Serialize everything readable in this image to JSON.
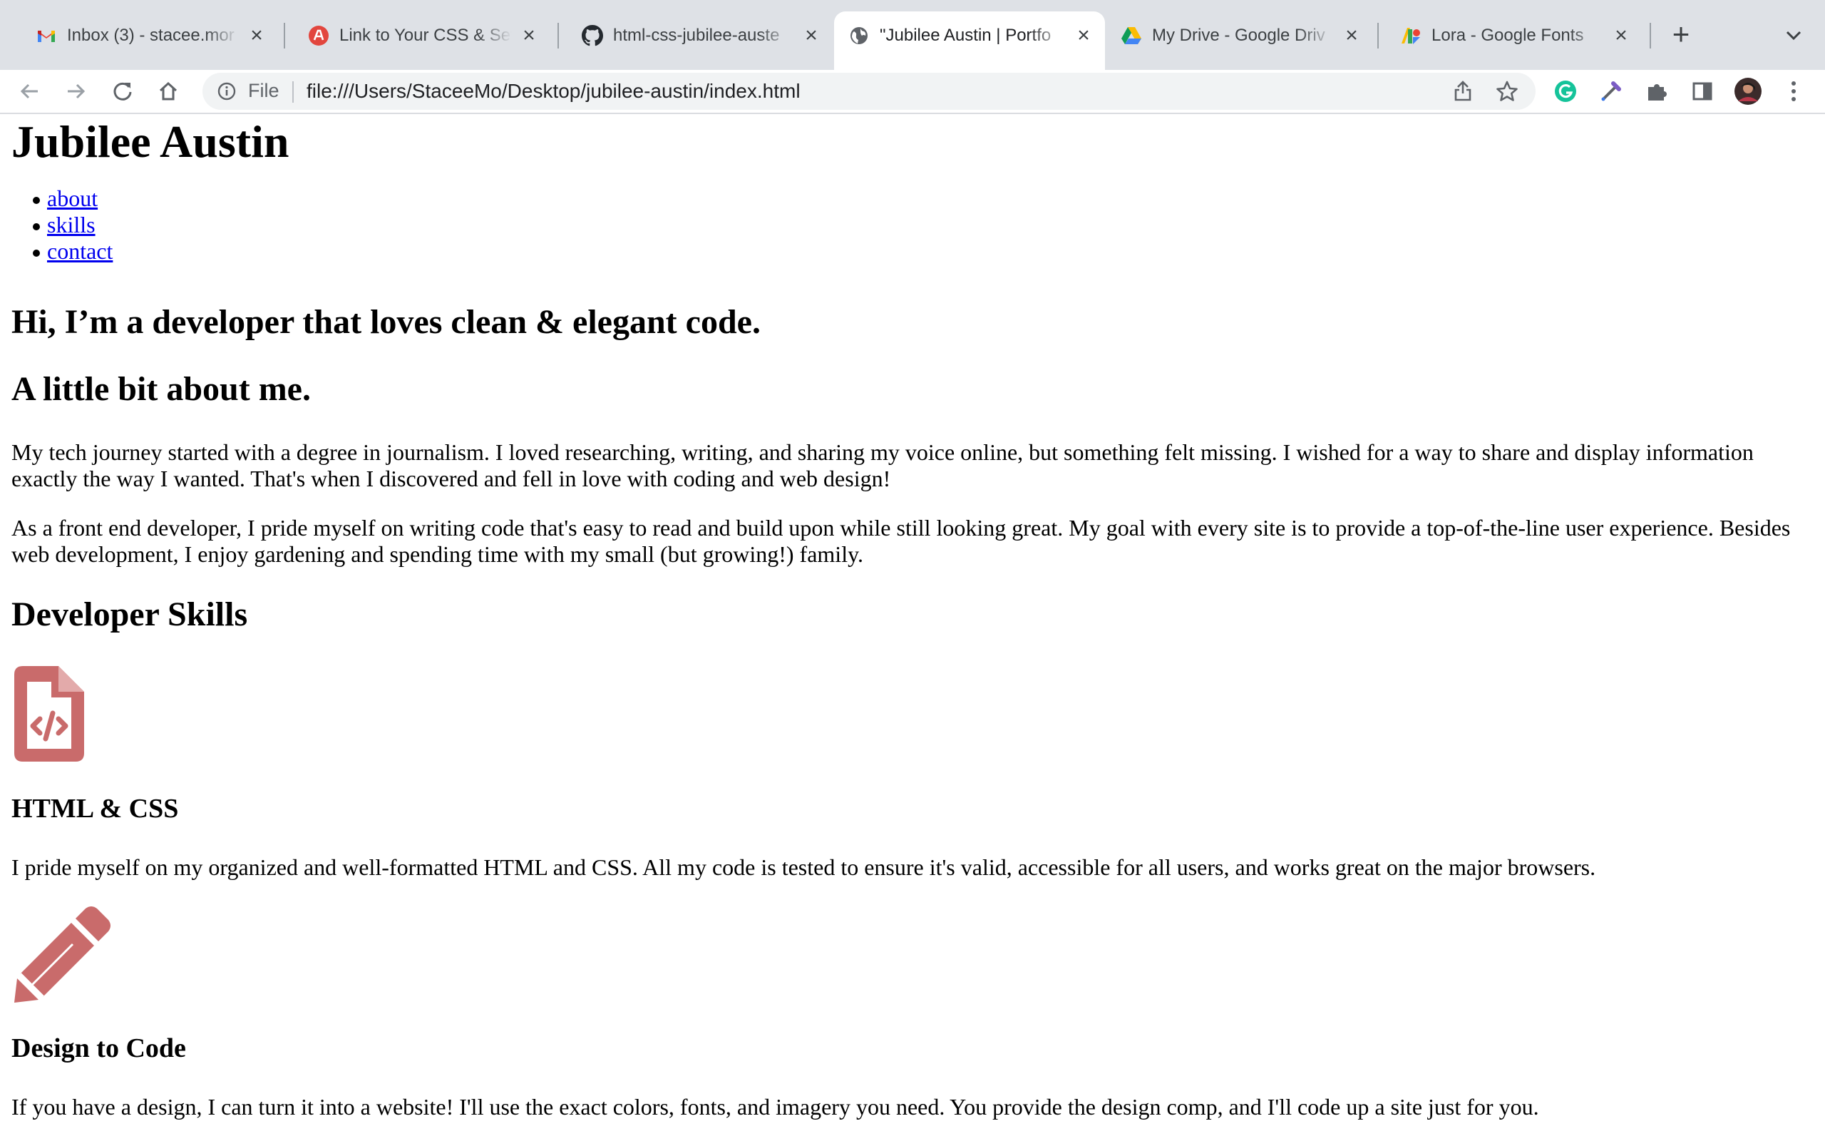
{
  "browser": {
    "tabs": [
      {
        "title": "Inbox (3) - stacee.mor",
        "icon": "gmail-icon",
        "active": false
      },
      {
        "title": "Link to Your CSS & Set",
        "icon": "course-icon",
        "active": false
      },
      {
        "title": "html-css-jubilee-auste",
        "icon": "github-icon",
        "active": false
      },
      {
        "title": "\"Jubilee Austin | Portfo",
        "icon": "globe-icon",
        "active": true
      },
      {
        "title": "My Drive - Google Driv",
        "icon": "google-drive-icon",
        "active": false
      },
      {
        "title": "Lora - Google Fonts",
        "icon": "google-fonts-icon",
        "active": false
      }
    ],
    "new_tab": "+",
    "omnibox": {
      "scheme_label": "File",
      "url": "file:///Users/StaceeMo/Desktop/jubilee-austin/index.html"
    }
  },
  "page": {
    "site_title": "Jubilee Austin",
    "nav": [
      {
        "label": "about"
      },
      {
        "label": "skills"
      },
      {
        "label": "contact"
      }
    ],
    "hero_heading": "Hi, I’m a developer that loves clean & elegant code.",
    "about": {
      "heading": "A little bit about me.",
      "paragraphs": [
        "My tech journey started with a degree in journalism. I loved researching, writing, and sharing my voice online, but something felt missing. I wished for a way to share and display information exactly the way I wanted. That's when I discovered and fell in love with coding and web design!",
        "As a front end developer, I pride myself on writing code that's easy to read and build upon while still looking great. My goal with every site is to provide a top-of-the-line user experience. Besides web development, I enjoy gardening and spending time with my small (but growing!) family."
      ]
    },
    "skills": {
      "heading": "Developer Skills",
      "items": [
        {
          "icon": "code-file-icon",
          "title": "HTML & CSS",
          "description": "I pride myself on my organized and well-formatted HTML and CSS. All my code is tested to ensure it's valid, accessible for all users, and works great on the major browsers."
        },
        {
          "icon": "pencil-icon",
          "title": "Design to Code",
          "description": "If you have a design, I can turn it into a website! I'll use the exact colors, fonts, and imagery you need. You provide the design comp, and I'll code up a site just for you."
        }
      ]
    },
    "colors": {
      "icon_accent": "#c96b6b",
      "link": "#0000ee"
    }
  }
}
